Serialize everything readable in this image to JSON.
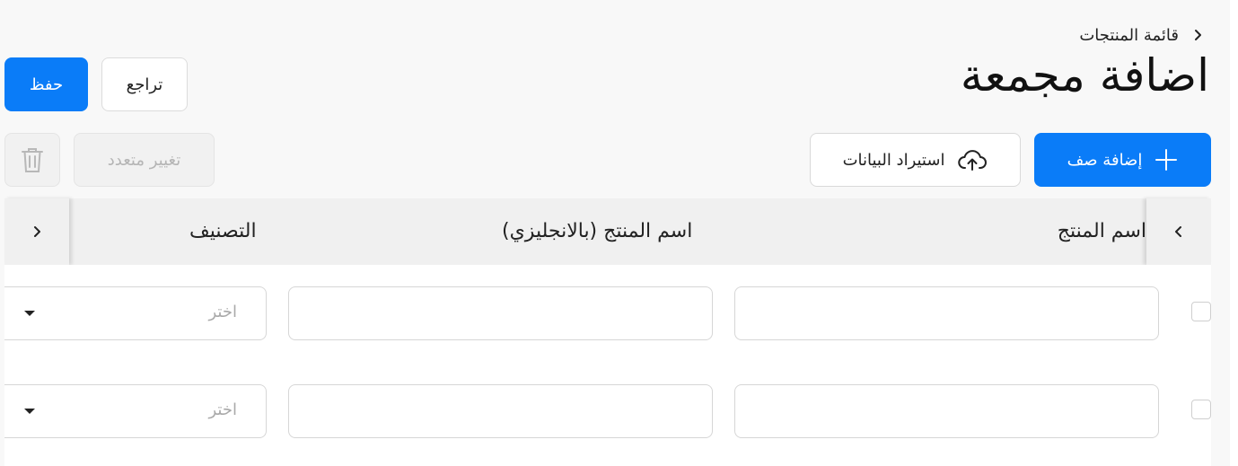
{
  "breadcrumb": {
    "label": "قائمة المنتجات"
  },
  "title": "اضافة مجمعة",
  "actions": {
    "save": "حفظ",
    "back": "تراجع"
  },
  "toolbar": {
    "bulk_change": "تغيير متعدد",
    "import": "استيراد البيانات",
    "add_row": "إضافة صف"
  },
  "table": {
    "columns": {
      "name": "اسم المنتج",
      "name_en": "اسم المنتج (بالانجليزي)",
      "category": "التصنيف"
    },
    "rows": [
      {
        "category_placeholder": "اختر"
      },
      {
        "category_placeholder": "اختر"
      }
    ]
  },
  "colors": {
    "primary": "#0a7cf8",
    "disabled_text": "#b5b5b5",
    "header_bg": "#f0f0f0"
  },
  "icons": [
    "chevron-right-icon",
    "trash-icon",
    "cloud-upload-icon",
    "plus-icon",
    "chevron-left-icon",
    "caret-down-icon"
  ]
}
